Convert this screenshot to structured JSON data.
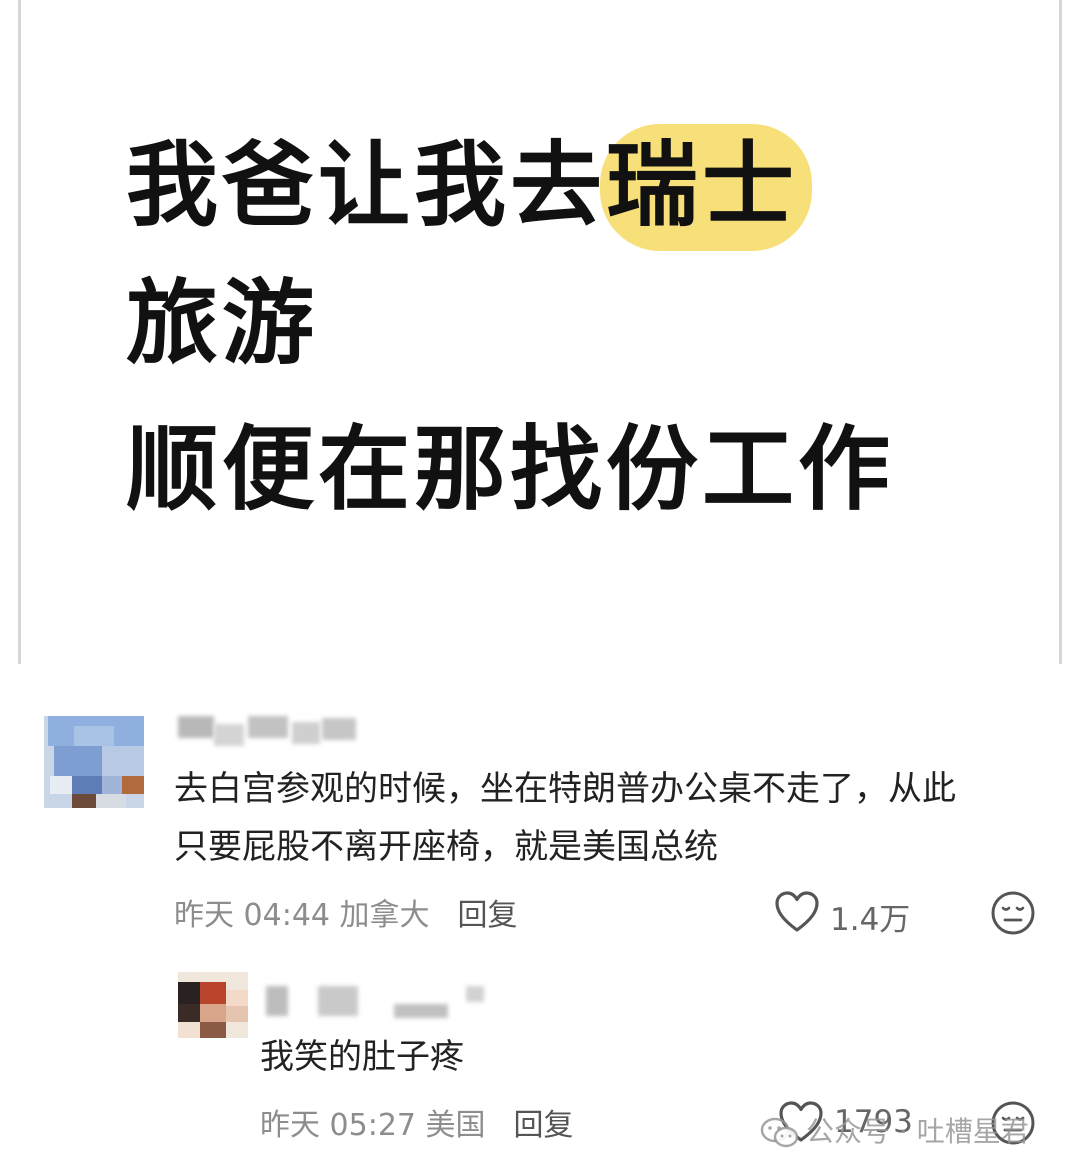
{
  "post": {
    "headline_line1_plain": "我爸让我去",
    "headline_line1_highlight": "瑞士",
    "headline_line2": "旅游",
    "headline_line3": "顺便在那找份工作",
    "highlight_color": "#f7e07a"
  },
  "comments": [
    {
      "text_line1": "去白宫参观的时候，坐在特朗普办公桌不走了，从此",
      "text_line2": "只要屁股不离开座椅，就是美国总统",
      "time": "昨天 04:44 加拿大",
      "reply_label": "回复",
      "likes": "1.4万",
      "like_icon": "heart-outline-icon",
      "emoji_icon": "neutral-face-icon"
    },
    {
      "text": "我笑的肚子疼",
      "time": "昨天 05:27 美国",
      "reply_label": "回复",
      "likes": "1793",
      "like_icon": "heart-outline-icon",
      "emoji_icon": "neutral-face-icon"
    }
  ],
  "watermark": {
    "text": "公众号 · 吐槽星君",
    "icon": "wechat-icon"
  }
}
